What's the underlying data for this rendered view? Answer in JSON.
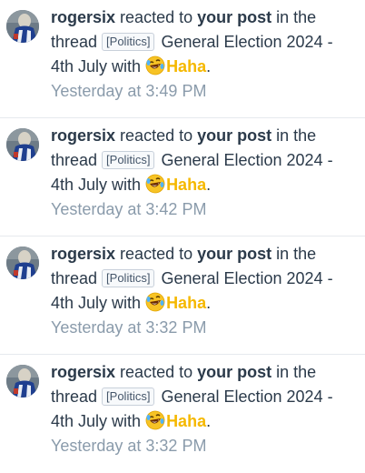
{
  "alerts": [
    {
      "username": "rogersix",
      "action_text": " reacted to ",
      "post_link": "your post",
      "in_the_thread": " in the thread ",
      "prefix": "[Politics]",
      "thread_title": " General Election 2024 - 4th July",
      "with_text": " with ",
      "reaction": "Haha",
      "period": ".",
      "time": "Yesterday at 3:49 PM"
    },
    {
      "username": "rogersix",
      "action_text": " reacted to ",
      "post_link": "your post",
      "in_the_thread": " in the thread ",
      "prefix": "[Politics]",
      "thread_title": " General Election 2024 - 4th July",
      "with_text": " with ",
      "reaction": "Haha",
      "period": ".",
      "time": "Yesterday at 3:42 PM"
    },
    {
      "username": "rogersix",
      "action_text": " reacted to ",
      "post_link": "your post",
      "in_the_thread": " in the thread ",
      "prefix": "[Politics]",
      "thread_title": " General Election 2024 - 4th July",
      "with_text": " with ",
      "reaction": "Haha",
      "period": ".",
      "time": "Yesterday at 3:32 PM"
    },
    {
      "username": "rogersix",
      "action_text": " reacted to ",
      "post_link": "your post",
      "in_the_thread": " in the thread ",
      "prefix": "[Politics]",
      "thread_title": " General Election 2024 - 4th July",
      "with_text": " with ",
      "reaction": "Haha",
      "period": ".",
      "time": "Yesterday at 3:32 PM"
    }
  ],
  "icons": {
    "avatar": "avatar-photo",
    "reaction": "face-with-tears-of-joy-emoji"
  },
  "colors": {
    "text": "#2b3a4a",
    "muted": "#8a9bab",
    "reaction": "#f5b800",
    "divider": "#e6e9ee"
  }
}
